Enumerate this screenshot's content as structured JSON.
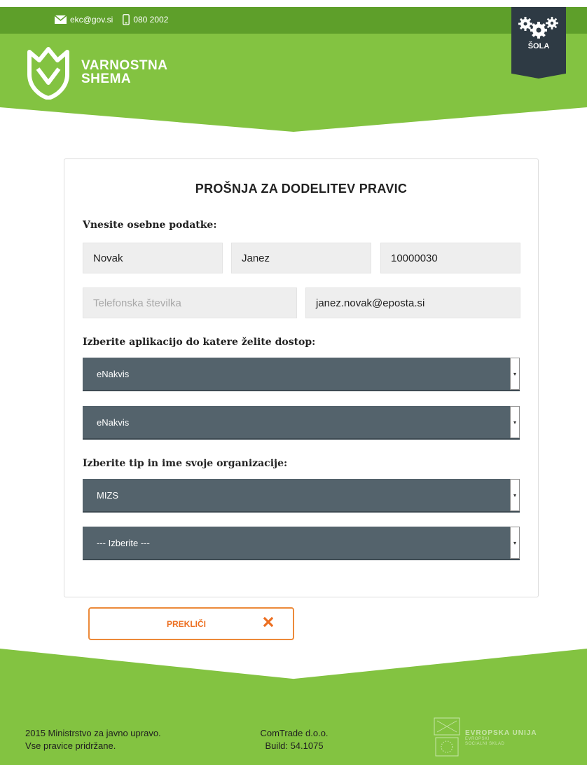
{
  "header": {
    "email": "ekc@gov.si",
    "phone": "080 2002",
    "logo_line1": "VARNOSTNA",
    "logo_line2": "SHEMA",
    "badge_label": "ŠOLA",
    "icons": {
      "email": "envelope-icon",
      "phone": "phone-icon",
      "logo": "tulip-shield-icon",
      "badge": "gears-icon"
    }
  },
  "form": {
    "title": "PROŠNJA ZA DODELITEV PRAVIC",
    "personal_label": "Vnesite osebne podatke:",
    "last_name": "Novak",
    "first_name": "Janez",
    "id_number": "10000030",
    "phone_placeholder": "Telefonska številka",
    "email": "janez.novak@eposta.si",
    "app_label": "Izberite aplikacijo do katere želite dostop:",
    "app_select_1": "eNakvis",
    "app_select_2": "eNakvis",
    "org_label": "Izberite tip in ime svoje organizacije:",
    "org_type_select": "MIZS",
    "org_name_select": "--- Izberite ---",
    "cancel_label": "PREKLIČI"
  },
  "footer": {
    "copyright_line1": "2015 Ministrstvo za javno upravo.",
    "copyright_line2": "Vse pravice pridržane.",
    "company": "ComTrade d.o.o.",
    "build": "Build: 54.1075",
    "eu_title": "EVROPSKA UNIJA",
    "eu_sub1": "EVROPSKI",
    "eu_sub2": "SOCIALNI SKLAD"
  },
  "colors": {
    "brand_green": "#83c341",
    "dark_green": "#5e9f2a",
    "badge_dark": "#2e3a44",
    "select_bg": "#54636c",
    "cancel_orange": "#ec8a3a"
  }
}
